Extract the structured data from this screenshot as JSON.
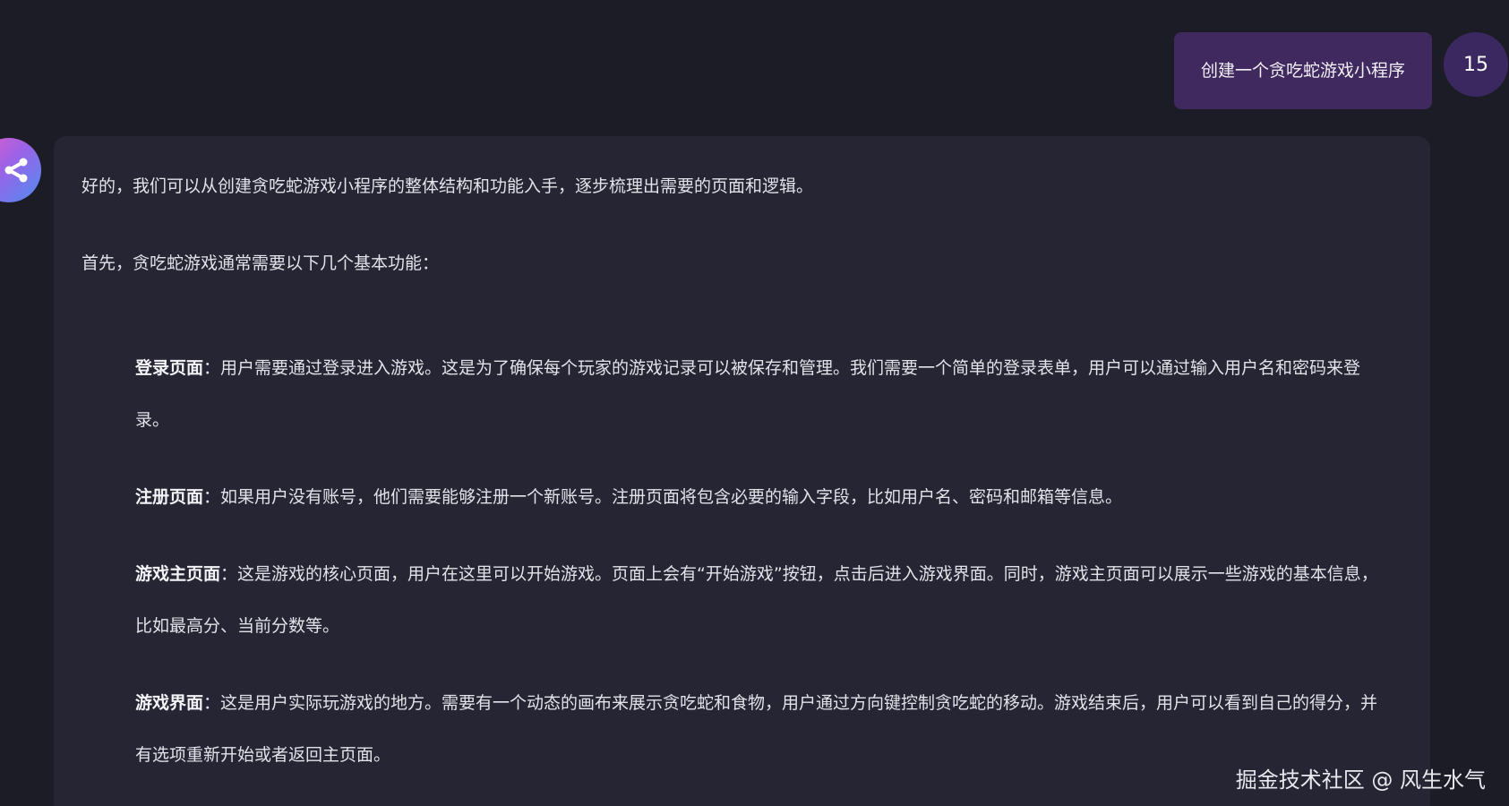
{
  "user_message": {
    "text": "创建一个贪吃蛇游戏小程序",
    "avatar_label": "15"
  },
  "assistant_message": {
    "intro": "好的，我们可以从创建贪吃蛇游戏小程序的整体结构和功能入手，逐步梳理出需要的页面和逻辑。",
    "lead": "首先，贪吃蛇游戏通常需要以下几个基本功能：",
    "items": [
      {
        "title": "登录页面",
        "body": "：用户需要通过登录进入游戏。这是为了确保每个玩家的游戏记录可以被保存和管理。我们需要一个简单的登录表单，用户可以通过输入用户名和密码来登录。"
      },
      {
        "title": "注册页面",
        "body": "：如果用户没有账号，他们需要能够注册一个新账号。注册页面将包含必要的输入字段，比如用户名、密码和邮箱等信息。"
      },
      {
        "title": "游戏主页面",
        "body": "：这是游戏的核心页面，用户在这里可以开始游戏。页面上会有“开始游戏”按钮，点击后进入游戏界面。同时，游戏主页面可以展示一些游戏的基本信息，比如最高分、当前分数等。"
      },
      {
        "title": "游戏界面",
        "body": "：这是用户实际玩游戏的地方。需要有一个动态的画布来展示贪吃蛇和食物，用户通过方向键控制贪吃蛇的移动。游戏结束后，用户可以看到自己的得分，并有选项重新开始或者返回主页面。"
      }
    ]
  },
  "watermark": "掘金技术社区 @ 风生水气",
  "colors": {
    "background": "#1c1c27",
    "assistant_card": "#252533",
    "user_bubble": "#40295e",
    "user_avatar": "#3c2860"
  },
  "icons": {
    "assistant_avatar": "share-icon"
  }
}
